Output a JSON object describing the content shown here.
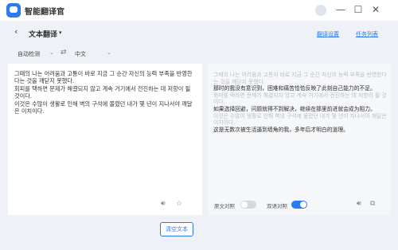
{
  "titlebar": {
    "app_title": "智能翻译官",
    "controls": [
      "—",
      "☐",
      "✕"
    ]
  },
  "header": {
    "back": "‹",
    "title": "文本翻译",
    "title_caret": "▾",
    "links": [
      "翻译设置",
      "任务列表"
    ]
  },
  "langbar": {
    "source_lang": "自动检测",
    "swap": "⇄",
    "target_lang": "中文",
    "caret": "⌄"
  },
  "source": {
    "lines": [
      "그때의 나는 어려움과 고통이 바로 지금 그 순간 자신의 능력 부족을 반영한다는 것을 깨닫지 못했다.",
      "회피를 택하면 문제가 해결되지 않고 계속 거기에서 전진하는 데 저항이 될 것이다.",
      "이것은 수많이 생활로 인해 벽의 구석에 몰렸던 내가 몇 년이 지나서야 깨달은 이치이다."
    ]
  },
  "output": {
    "segments": [
      {
        "text": "그때의 나는 어려움과 고통이 바로 지금 그 순간 자신의 능력 부족을 반영한다는 것을 깨닫지 못했다.",
        "style": "ghost"
      },
      {
        "text": "那时的我没有意识到，困难和痛苦恰恰反映了此刻自己能力的不足。",
        "style": "dark"
      },
      {
        "text": "회피를 택하면 문제가 해결되지 않고 계속 거기에서 전진하는 데 저항이 될 것이다.",
        "style": "ghost"
      },
      {
        "text": "如果选择回避，问题就得不到解决，继续在那里前进就会成为阻力。",
        "style": "dark"
      },
      {
        "text": "이것은 수많이 생활로 인해 벽의 구석에 몰렸던 내가 몇 년이 지나서야 깨달은 이치이다.",
        "style": "ghost"
      },
      {
        "text": "这是无数次被生活逼到墙角的我，多年后才明白的道理。",
        "style": "dark"
      }
    ],
    "toggle_compare_label": "原文对照",
    "toggle_compare_on": false,
    "toggle_bilingual_label": "双语对照",
    "toggle_bilingual_on": true
  },
  "actions": {
    "clear_label": "清空文本",
    "speaker_icon": "speaker-icon",
    "star_icon": "star-icon",
    "copy_icon": "copy-icon"
  },
  "colors": {
    "accent": "#2b7bf0",
    "background": "#eef1f6",
    "ghost_text": "#b9bec8"
  }
}
